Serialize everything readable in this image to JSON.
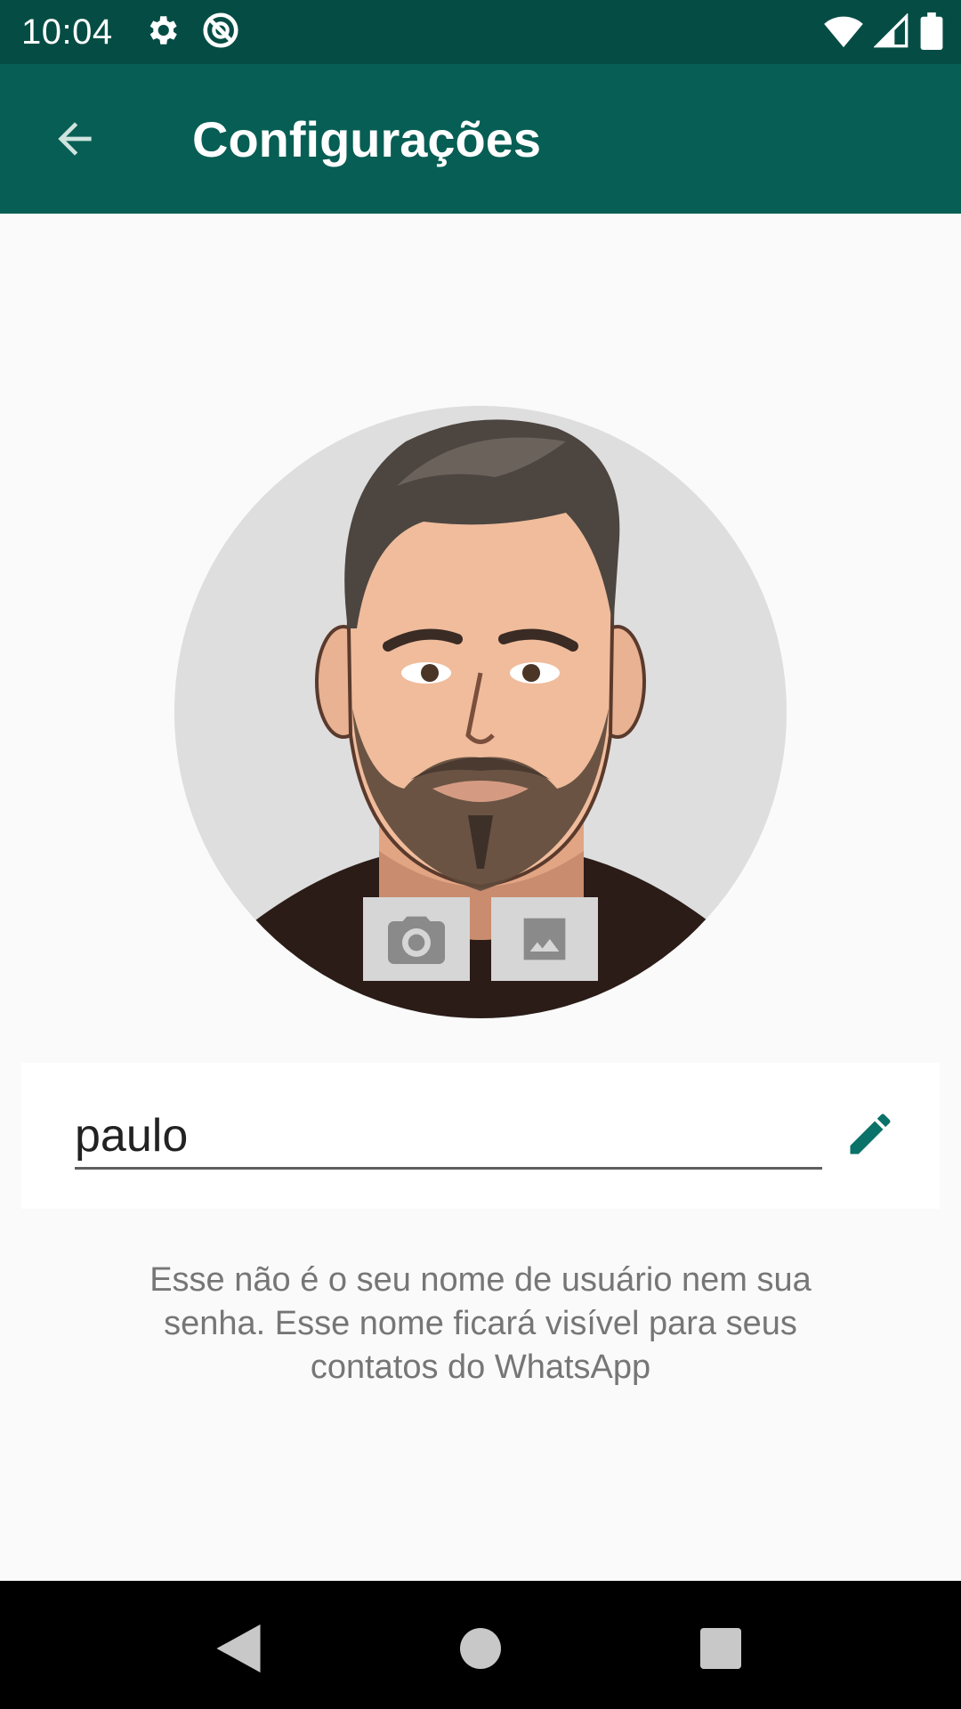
{
  "status_bar": {
    "time": "10:04",
    "icons": [
      "settings-icon",
      "no-data-icon",
      "wifi-icon",
      "signal-icon",
      "battery-icon"
    ]
  },
  "app_bar": {
    "title": "Configurações",
    "back_icon": "arrow-back-icon"
  },
  "profile": {
    "photo_alt": "avatar",
    "camera_icon": "camera-icon",
    "gallery_icon": "image-icon"
  },
  "name_field": {
    "value": "paulo",
    "edit_icon": "pencil-icon"
  },
  "hint": "Esse não é o seu nome de usuário nem sua senha. Esse nome ficará visível para seus contatos do WhatsApp",
  "nav_bar": {
    "icons": [
      "back-triangle-icon",
      "home-circle-icon",
      "recents-square-icon"
    ]
  },
  "colors": {
    "status_bar": "#054d44",
    "app_bar": "#075e54",
    "accent": "#0a7268",
    "background": "#fafafa"
  }
}
